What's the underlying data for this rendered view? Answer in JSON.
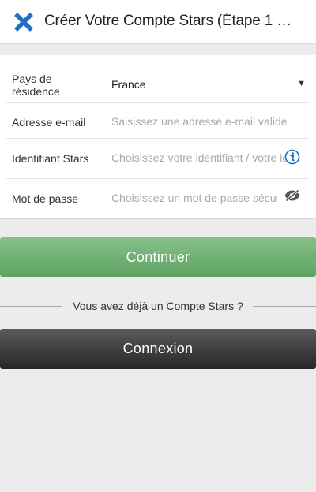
{
  "header": {
    "title": "Créer Votre Compte Stars (Étape 1 …",
    "close_icon": "close-icon",
    "accent_color": "#1f6fc4"
  },
  "form": {
    "country": {
      "label_line1": "Pays de",
      "label_line2": "résidence",
      "value": "France",
      "arrow": "▼"
    },
    "email": {
      "label": "Adresse e-mail",
      "placeholder": "Saisissez une adresse e-mail valide"
    },
    "stars_id": {
      "label": "Identifiant Stars",
      "placeholder": "Choisissez votre identifiant / votre identifiant",
      "icon": "info-icon"
    },
    "password": {
      "label": "Mot de passe",
      "placeholder": "Choisissez un mot de passe sécurisé",
      "icon": "eye-slash-icon"
    }
  },
  "buttons": {
    "continue_label": "Continuer",
    "continue_color": "#6fb073",
    "login_label": "Connexion",
    "login_color": "#3a3a3a"
  },
  "existing_account_text": "Vous avez déjà un Compte Stars ?"
}
